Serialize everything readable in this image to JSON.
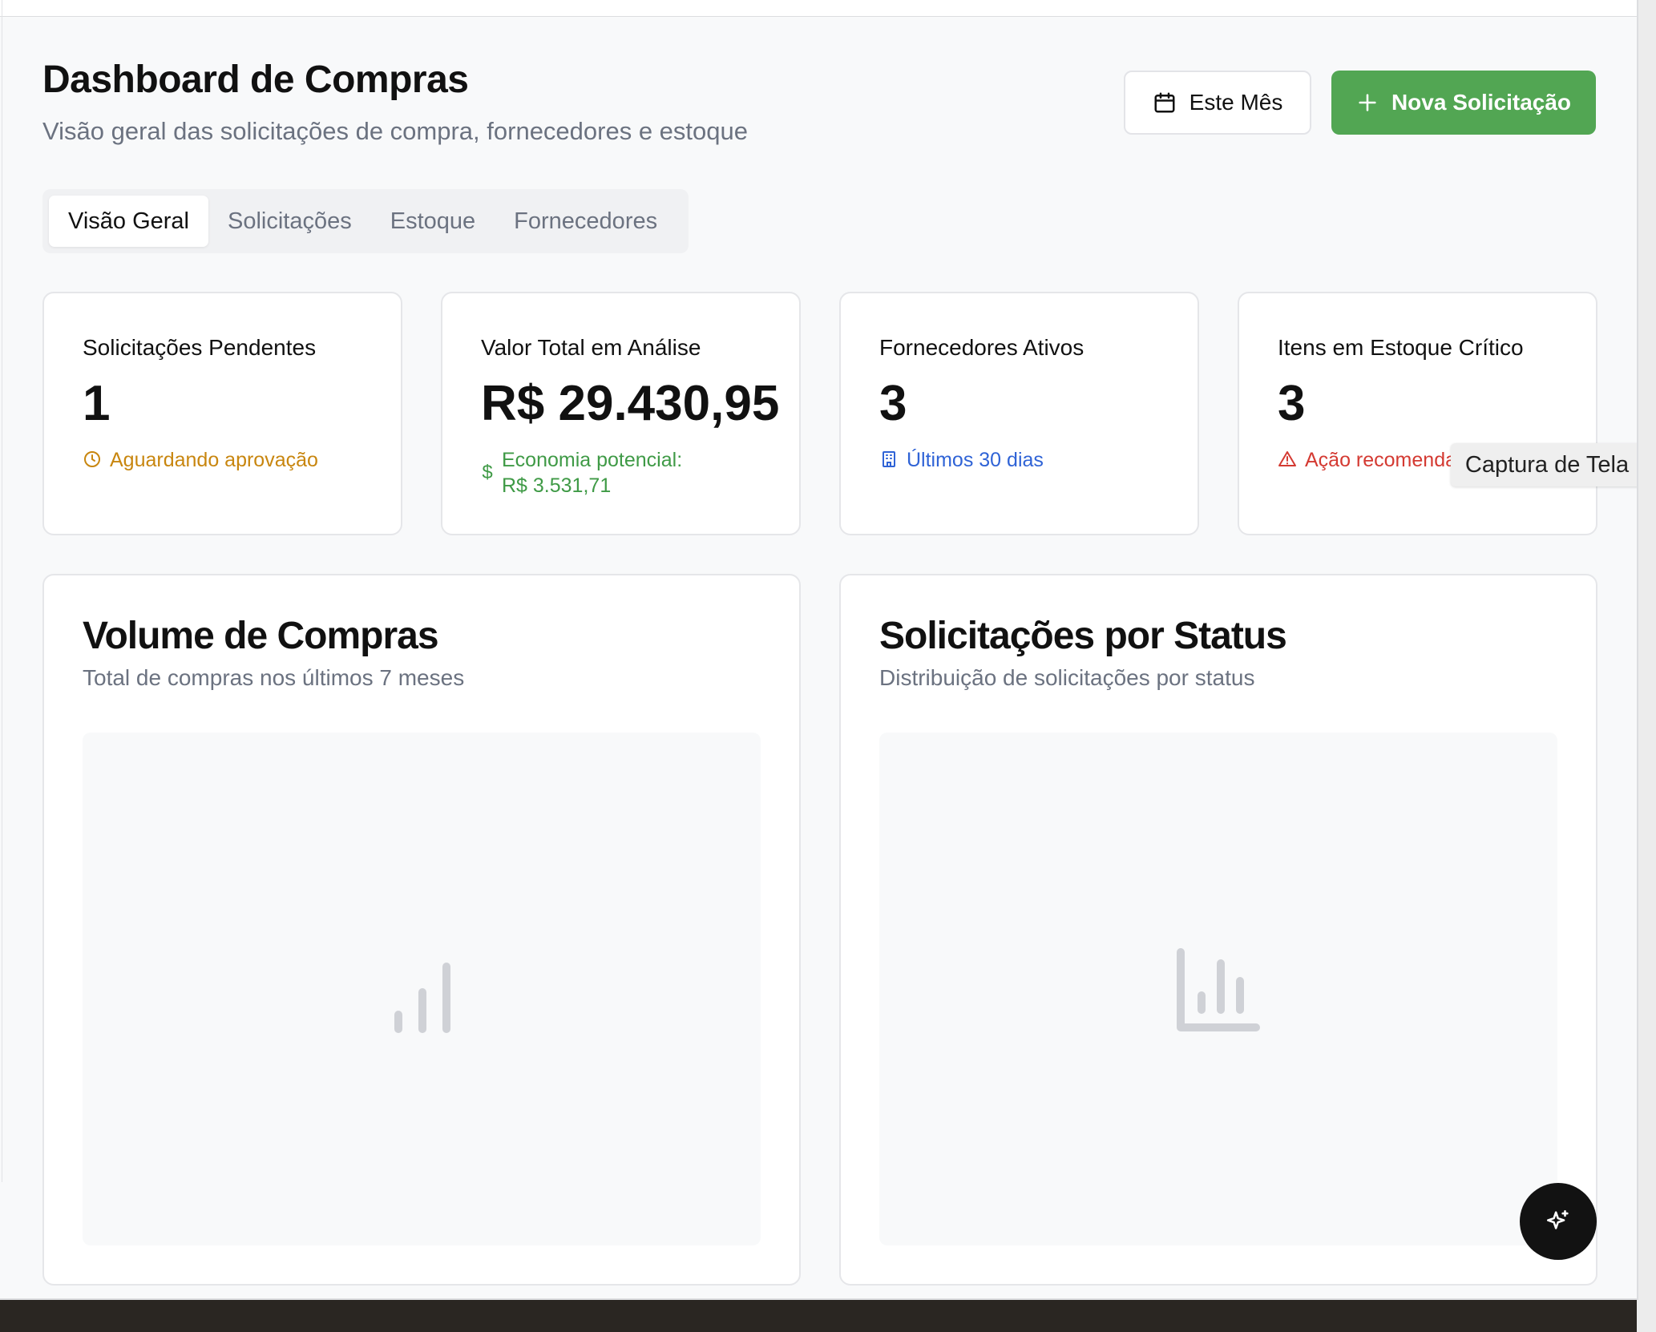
{
  "header": {
    "title": "Dashboard de Compras",
    "subtitle": "Visão geral das solicitações de compra, fornecedores e estoque",
    "month_button": "Este Mês",
    "new_button": "Nova Solicitação"
  },
  "tabs": [
    {
      "label": "Visão Geral",
      "active": true
    },
    {
      "label": "Solicitações",
      "active": false
    },
    {
      "label": "Estoque",
      "active": false
    },
    {
      "label": "Fornecedores",
      "active": false
    }
  ],
  "kpis": [
    {
      "label": "Solicitações Pendentes",
      "value": "1",
      "note": "Aguardando aprovação",
      "icon": "clock-icon",
      "color": "#c8860f"
    },
    {
      "label": "Valor Total em Análise",
      "value": "R$ 29.430,95",
      "note": "Economia potencial:",
      "note2": "R$ 3.531,71",
      "icon": "dollar-icon",
      "color": "#3f9a46"
    },
    {
      "label": "Fornecedores Ativos",
      "value": "3",
      "note": "Últimos 30 dias",
      "icon": "building-icon",
      "color": "#2f63d6"
    },
    {
      "label": "Itens em Estoque Crítico",
      "value": "3",
      "note": "Ação recomenda",
      "icon": "warning-icon",
      "color": "#d43a32"
    }
  ],
  "charts": [
    {
      "title": "Volume de Compras",
      "subtitle": "Total de compras nos últimos 7 meses",
      "placeholder_icon": "bar-chart-icon"
    },
    {
      "title": "Solicitações por Status",
      "subtitle": "Distribuição de solicitações por status",
      "placeholder_icon": "bar-chart-axis-icon"
    }
  ],
  "tooltip": "Captura de Tela",
  "fab_icon": "sparkle-icon",
  "colors": {
    "accent_green": "#52a653",
    "muted": "#6b7280"
  }
}
